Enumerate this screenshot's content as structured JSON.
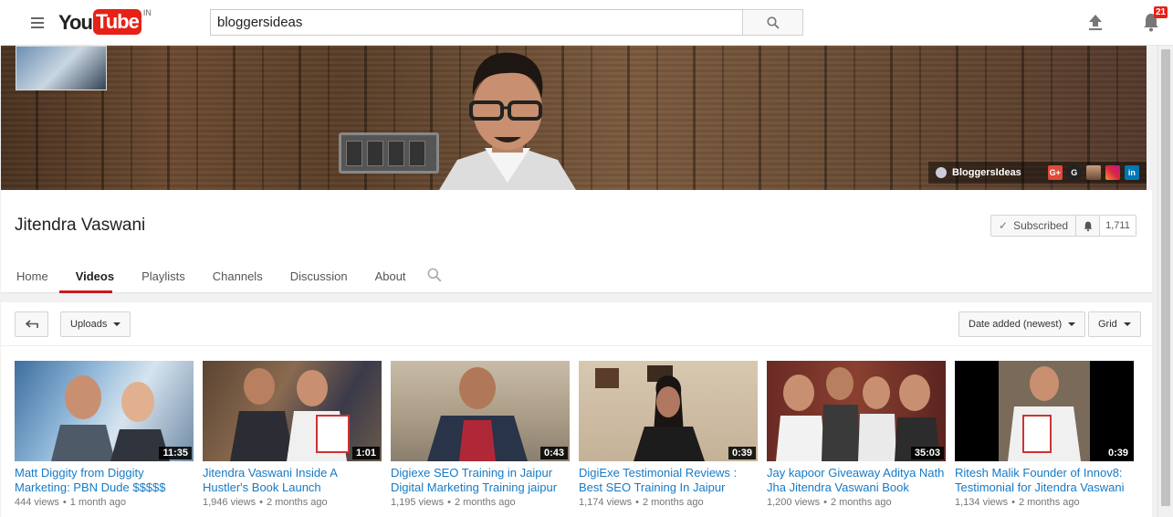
{
  "masthead": {
    "logo_you": "You",
    "logo_tube": "Tube",
    "logo_country": "IN",
    "search_value": "bloggersideas",
    "notification_count": "21"
  },
  "banner": {
    "site_link": "BloggersIdeas",
    "social": [
      {
        "name": "google-plus",
        "label": "G+",
        "color": "#dd4b39"
      },
      {
        "name": "google",
        "label": "G",
        "color": "#222222"
      },
      {
        "name": "profile",
        "label": "",
        "color": "#a07050"
      },
      {
        "name": "instagram",
        "label": "",
        "color": "#c13584"
      },
      {
        "name": "linkedin",
        "label": "in",
        "color": "#0077b5"
      }
    ]
  },
  "channel": {
    "title": "Jitendra Vaswani",
    "subscribed_label": "Subscribed",
    "subscriber_count": "1,711",
    "tabs": [
      "Home",
      "Videos",
      "Playlists",
      "Channels",
      "Discussion",
      "About"
    ],
    "active_tab": "Videos"
  },
  "toolbar": {
    "uploads_label": "Uploads",
    "sort_label": "Date added (newest)",
    "view_label": "Grid"
  },
  "videos": [
    {
      "title": "Matt Diggity from Diggity Marketing: PBN Dude $$$$$",
      "views": "444 views",
      "age": "1 month ago",
      "duration": "11:35"
    },
    {
      "title": "Jitendra Vaswani Inside A Hustler's Book Launch",
      "views": "1,946 views",
      "age": "2 months ago",
      "duration": "1:01"
    },
    {
      "title": "Digiexe SEO Training in Jaipur Digital Marketing Training jaipur",
      "views": "1,195 views",
      "age": "2 months ago",
      "duration": "0:43"
    },
    {
      "title": "DigiExe Testimonial Reviews : Best SEO Training In Jaipur",
      "views": "1,174 views",
      "age": "2 months ago",
      "duration": "0:39"
    },
    {
      "title": "Jay kapoor Giveaway Aditya Nath Jha Jitendra Vaswani Book",
      "views": "1,200 views",
      "age": "2 months ago",
      "duration": "35:03"
    },
    {
      "title": "Ritesh Malik Founder of Innov8: Testimonial for Jitendra Vaswani",
      "views": "1,134 views",
      "age": "2 months ago",
      "duration": "0:39"
    }
  ]
}
